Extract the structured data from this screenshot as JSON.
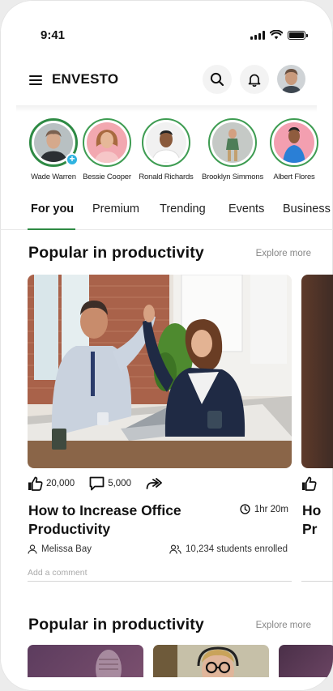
{
  "status": {
    "time": "9:41"
  },
  "header": {
    "logo": "ENVESTO"
  },
  "stories": [
    {
      "name": "Wade Warren",
      "add": "+"
    },
    {
      "name": "Bessie Cooper"
    },
    {
      "name": "Ronald Richards"
    },
    {
      "name": "Brooklyn Simmons"
    },
    {
      "name": "Albert Flores"
    }
  ],
  "tabs": [
    "For you",
    "Premium",
    "Trending",
    "Events",
    "Business"
  ],
  "section1": {
    "title": "Popular in productivity",
    "explore": "Explore more"
  },
  "card": {
    "likes": "20,000",
    "comments": "5,000",
    "title": "How to Increase Office Productivity",
    "duration": "1hr 20m",
    "author": "Melissa Bay",
    "enrolled": "10,234 students enrolled",
    "comment_placeholder": "Add a comment"
  },
  "peek": {
    "title_line1": "Ho",
    "title_line2": "Pr"
  },
  "section2": {
    "title": "Popular in productivity",
    "explore": "Explore more"
  },
  "colors": {
    "accent": "#2e8a44",
    "add_badge": "#2fb3e0"
  }
}
